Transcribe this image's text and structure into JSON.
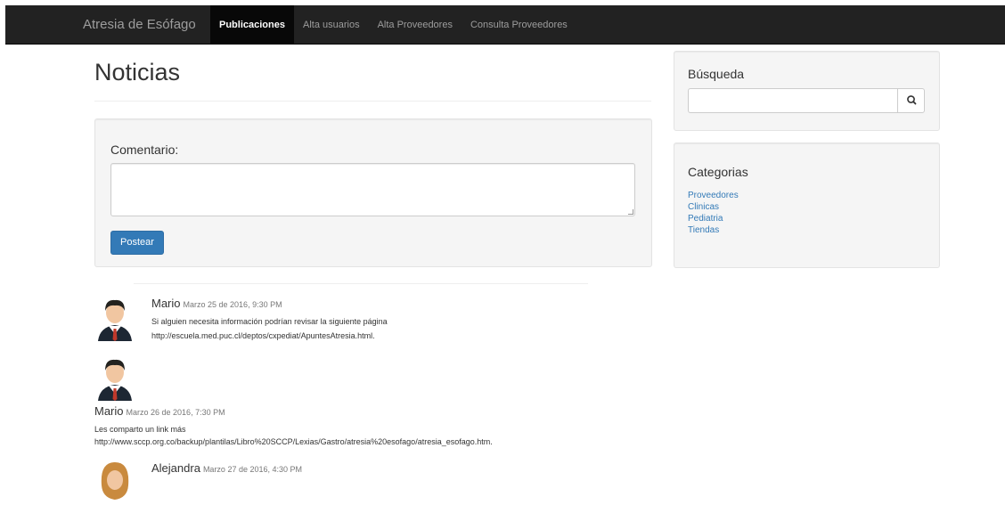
{
  "navbar": {
    "brand": "Atresia de Esófago",
    "items": [
      {
        "label": "Publicaciones",
        "active": true
      },
      {
        "label": "Alta usuarios",
        "active": false
      },
      {
        "label": "Alta Proveedores",
        "active": false
      },
      {
        "label": "Consulta Proveedores",
        "active": false
      }
    ]
  },
  "main": {
    "title": "Noticias",
    "comment_form": {
      "label": "Comentario:",
      "textarea_value": "",
      "submit_label": "Postear"
    },
    "comments": [
      {
        "author": "Mario",
        "date": "Marzo 25 de 2016, 9:30 PM",
        "lines": [
          "Si alguien necesita información podrían revisar la siguiente página",
          "http://escuela.med.puc.cl/deptos/cxpediat/ApuntesAtresia.html."
        ],
        "avatar": "male-avatar-icon"
      },
      {
        "author": "Mario",
        "date": "Marzo 26 de 2016, 7:30 PM",
        "lines": [
          "Les comparto un link más",
          "http://www.sccp.org.co/backup/plantilas/Libro%20SCCP/Lexias/Gastro/atresia%20esofago/atresia_esofago.htm."
        ],
        "avatar": "male-avatar-icon"
      },
      {
        "author": "Alejandra",
        "date": "Marzo 27 de 2016, 4:30 PM",
        "lines": [],
        "avatar": "female-avatar-icon"
      }
    ]
  },
  "sidebar": {
    "search": {
      "title": "Búsqueda",
      "placeholder": "",
      "button_icon": "search-icon"
    },
    "categories": {
      "title": "Categorias",
      "items": [
        "Proveedores",
        "Clinicas",
        "Pediatria",
        "Tiendas"
      ]
    }
  },
  "colors": {
    "navbar_bg": "#222222",
    "link": "#337ab7",
    "primary_button": "#337ab7",
    "well_bg": "#f5f5f5"
  }
}
